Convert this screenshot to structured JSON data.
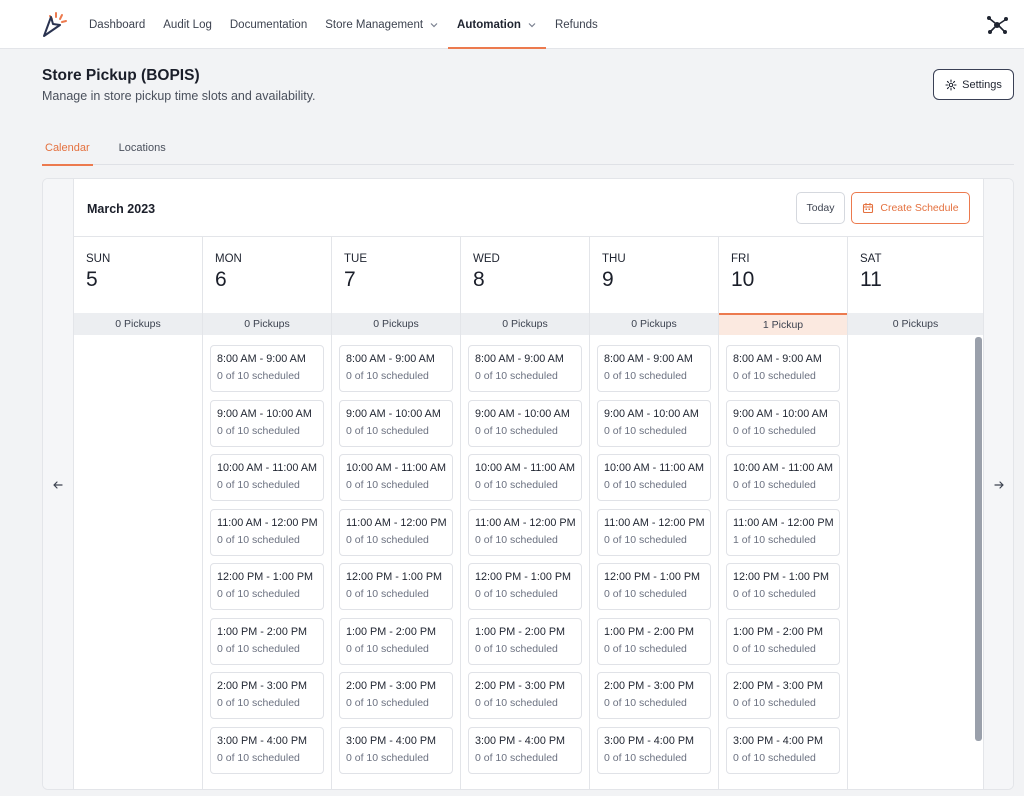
{
  "nav": {
    "items": [
      {
        "label": "Dashboard",
        "has_dropdown": false,
        "active": false
      },
      {
        "label": "Audit Log",
        "has_dropdown": false,
        "active": false
      },
      {
        "label": "Documentation",
        "has_dropdown": false,
        "active": false
      },
      {
        "label": "Store Management",
        "has_dropdown": true,
        "active": false
      },
      {
        "label": "Automation",
        "has_dropdown": true,
        "active": true
      },
      {
        "label": "Refunds",
        "has_dropdown": false,
        "active": false
      }
    ],
    "right_icon": "integrations-icon"
  },
  "header": {
    "title": "Store Pickup (BOPIS)",
    "subtitle": "Manage in store pickup time slots and availability.",
    "settings_label": "Settings"
  },
  "tabs": [
    {
      "label": "Calendar",
      "active": true
    },
    {
      "label": "Locations",
      "active": false
    }
  ],
  "calendar": {
    "month": "March 2023",
    "today_label": "Today",
    "create_label": "Create Schedule",
    "days": [
      {
        "name": "SUN",
        "num": "5",
        "pickups": "0 Pickups",
        "highlight": false,
        "slots": []
      },
      {
        "name": "MON",
        "num": "6",
        "pickups": "0 Pickups",
        "highlight": false,
        "slots": [
          {
            "time": "8:00 AM - 9:00 AM",
            "count": "0 of 10 scheduled"
          },
          {
            "time": "9:00 AM - 10:00 AM",
            "count": "0 of 10 scheduled"
          },
          {
            "time": "10:00 AM - 11:00 AM",
            "count": "0 of 10 scheduled"
          },
          {
            "time": "11:00 AM - 12:00 PM",
            "count": "0 of 10 scheduled"
          },
          {
            "time": "12:00 PM - 1:00 PM",
            "count": "0 of 10 scheduled"
          },
          {
            "time": "1:00 PM - 2:00 PM",
            "count": "0 of 10 scheduled"
          },
          {
            "time": "2:00 PM - 3:00 PM",
            "count": "0 of 10 scheduled"
          },
          {
            "time": "3:00 PM - 4:00 PM",
            "count": "0 of 10 scheduled"
          }
        ]
      },
      {
        "name": "TUE",
        "num": "7",
        "pickups": "0 Pickups",
        "highlight": false,
        "slots": [
          {
            "time": "8:00 AM - 9:00 AM",
            "count": "0 of 10 scheduled"
          },
          {
            "time": "9:00 AM - 10:00 AM",
            "count": "0 of 10 scheduled"
          },
          {
            "time": "10:00 AM - 11:00 AM",
            "count": "0 of 10 scheduled"
          },
          {
            "time": "11:00 AM - 12:00 PM",
            "count": "0 of 10 scheduled"
          },
          {
            "time": "12:00 PM - 1:00 PM",
            "count": "0 of 10 scheduled"
          },
          {
            "time": "1:00 PM - 2:00 PM",
            "count": "0 of 10 scheduled"
          },
          {
            "time": "2:00 PM - 3:00 PM",
            "count": "0 of 10 scheduled"
          },
          {
            "time": "3:00 PM - 4:00 PM",
            "count": "0 of 10 scheduled"
          }
        ]
      },
      {
        "name": "WED",
        "num": "8",
        "pickups": "0 Pickups",
        "highlight": false,
        "slots": [
          {
            "time": "8:00 AM - 9:00 AM",
            "count": "0 of 10 scheduled"
          },
          {
            "time": "9:00 AM - 10:00 AM",
            "count": "0 of 10 scheduled"
          },
          {
            "time": "10:00 AM - 11:00 AM",
            "count": "0 of 10 scheduled"
          },
          {
            "time": "11:00 AM - 12:00 PM",
            "count": "0 of 10 scheduled"
          },
          {
            "time": "12:00 PM - 1:00 PM",
            "count": "0 of 10 scheduled"
          },
          {
            "time": "1:00 PM - 2:00 PM",
            "count": "0 of 10 scheduled"
          },
          {
            "time": "2:00 PM - 3:00 PM",
            "count": "0 of 10 scheduled"
          },
          {
            "time": "3:00 PM - 4:00 PM",
            "count": "0 of 10 scheduled"
          }
        ]
      },
      {
        "name": "THU",
        "num": "9",
        "pickups": "0 Pickups",
        "highlight": false,
        "slots": [
          {
            "time": "8:00 AM - 9:00 AM",
            "count": "0 of 10 scheduled"
          },
          {
            "time": "9:00 AM - 10:00 AM",
            "count": "0 of 10 scheduled"
          },
          {
            "time": "10:00 AM - 11:00 AM",
            "count": "0 of 10 scheduled"
          },
          {
            "time": "11:00 AM - 12:00 PM",
            "count": "0 of 10 scheduled"
          },
          {
            "time": "12:00 PM - 1:00 PM",
            "count": "0 of 10 scheduled"
          },
          {
            "time": "1:00 PM - 2:00 PM",
            "count": "0 of 10 scheduled"
          },
          {
            "time": "2:00 PM - 3:00 PM",
            "count": "0 of 10 scheduled"
          },
          {
            "time": "3:00 PM - 4:00 PM",
            "count": "0 of 10 scheduled"
          }
        ]
      },
      {
        "name": "FRI",
        "num": "10",
        "pickups": "1 Pickup",
        "highlight": true,
        "slots": [
          {
            "time": "8:00 AM - 9:00 AM",
            "count": "0 of 10 scheduled"
          },
          {
            "time": "9:00 AM - 10:00 AM",
            "count": "0 of 10 scheduled"
          },
          {
            "time": "10:00 AM - 11:00 AM",
            "count": "0 of 10 scheduled"
          },
          {
            "time": "11:00 AM - 12:00 PM",
            "count": "1 of 10 scheduled"
          },
          {
            "time": "12:00 PM - 1:00 PM",
            "count": "0 of 10 scheduled"
          },
          {
            "time": "1:00 PM - 2:00 PM",
            "count": "0 of 10 scheduled"
          },
          {
            "time": "2:00 PM - 3:00 PM",
            "count": "0 of 10 scheduled"
          },
          {
            "time": "3:00 PM - 4:00 PM",
            "count": "0 of 10 scheduled"
          }
        ]
      },
      {
        "name": "SAT",
        "num": "11",
        "pickups": "0 Pickups",
        "highlight": false,
        "slots": []
      }
    ]
  },
  "colors": {
    "accent": "#ec7a4e",
    "accent_bg": "#fbe9e0",
    "page_bg": "#f2f3f5"
  }
}
